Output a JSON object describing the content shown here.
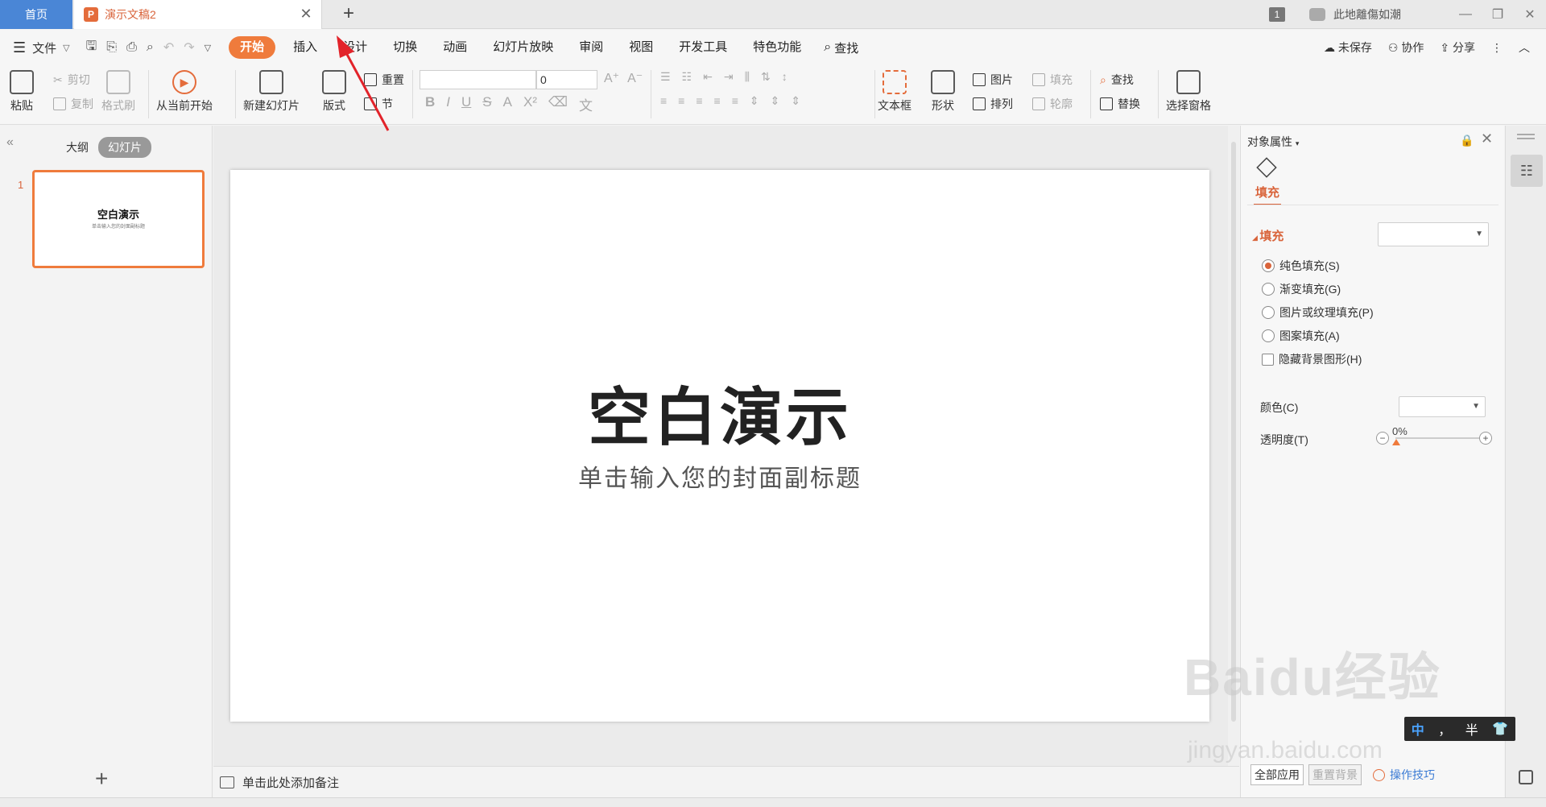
{
  "tabs": {
    "home": "首页",
    "doc": "演示文稿2",
    "doc_icon": "P",
    "close": "✕",
    "add": "+"
  },
  "window": {
    "badge": "1",
    "user": "此地離傷如潮",
    "minimize": "—",
    "restore": "❐",
    "close": "✕"
  },
  "menu": {
    "file": "文件",
    "tabs": [
      "开始",
      "插入",
      "设计",
      "切换",
      "动画",
      "幻灯片放映",
      "审阅",
      "视图",
      "开发工具",
      "特色功能"
    ],
    "search": "查找",
    "right": [
      "未保存",
      "协作",
      "分享"
    ]
  },
  "ribbon": {
    "paste": "粘贴",
    "cut": "剪切",
    "copy": "复制",
    "format_painter": "格式刷",
    "from_start": "从当前开始",
    "new_slide": "新建幻灯片",
    "layout": "版式",
    "reset": "重置",
    "section": "节",
    "font_size": "0",
    "textbox": "文本框",
    "shape": "形状",
    "picture": "图片",
    "arrange": "排列",
    "fill": "填充",
    "outline": "轮廓",
    "find": "查找",
    "replace": "替换",
    "selection_pane": "选择窗格",
    "format_glyphs": [
      "B",
      "I",
      "U",
      "S",
      "A",
      "X²",
      "⌫",
      "文"
    ]
  },
  "leftpanel": {
    "tabs": [
      "大纲",
      "幻灯片"
    ],
    "slide_number": "1",
    "thumb_title": "空白演示",
    "thumb_sub": "单击输入您的封面副标题",
    "add": "+"
  },
  "slide": {
    "title": "空白演示",
    "subtitle": "单击输入您的封面副标题"
  },
  "notes": {
    "placeholder": "单击此处添加备注"
  },
  "properties": {
    "title": "对象属性",
    "fill_tab": "填充",
    "fill_section": "填充",
    "options": [
      {
        "label": "纯色填充(S)",
        "checked": true
      },
      {
        "label": "渐变填充(G)",
        "checked": false
      },
      {
        "label": "图片或纹理填充(P)",
        "checked": false
      },
      {
        "label": "图案填充(A)",
        "checked": false
      }
    ],
    "hide_bg": "隐藏背景图形(H)",
    "color_label": "颜色(C)",
    "transparency_label": "透明度(T)",
    "transparency_value": "0%",
    "apply_all": "全部应用",
    "reset_bg": "重置背景",
    "tips": "操作技巧"
  },
  "watermark": {
    "text": "Baidu经验",
    "url": "jingyan.baidu.com"
  },
  "ime": [
    "中",
    "，",
    "半",
    "👕"
  ],
  "colors": {
    "accent": "#ef7b3c",
    "home_tab": "#4a86d6",
    "link": "#3b7bd4"
  }
}
